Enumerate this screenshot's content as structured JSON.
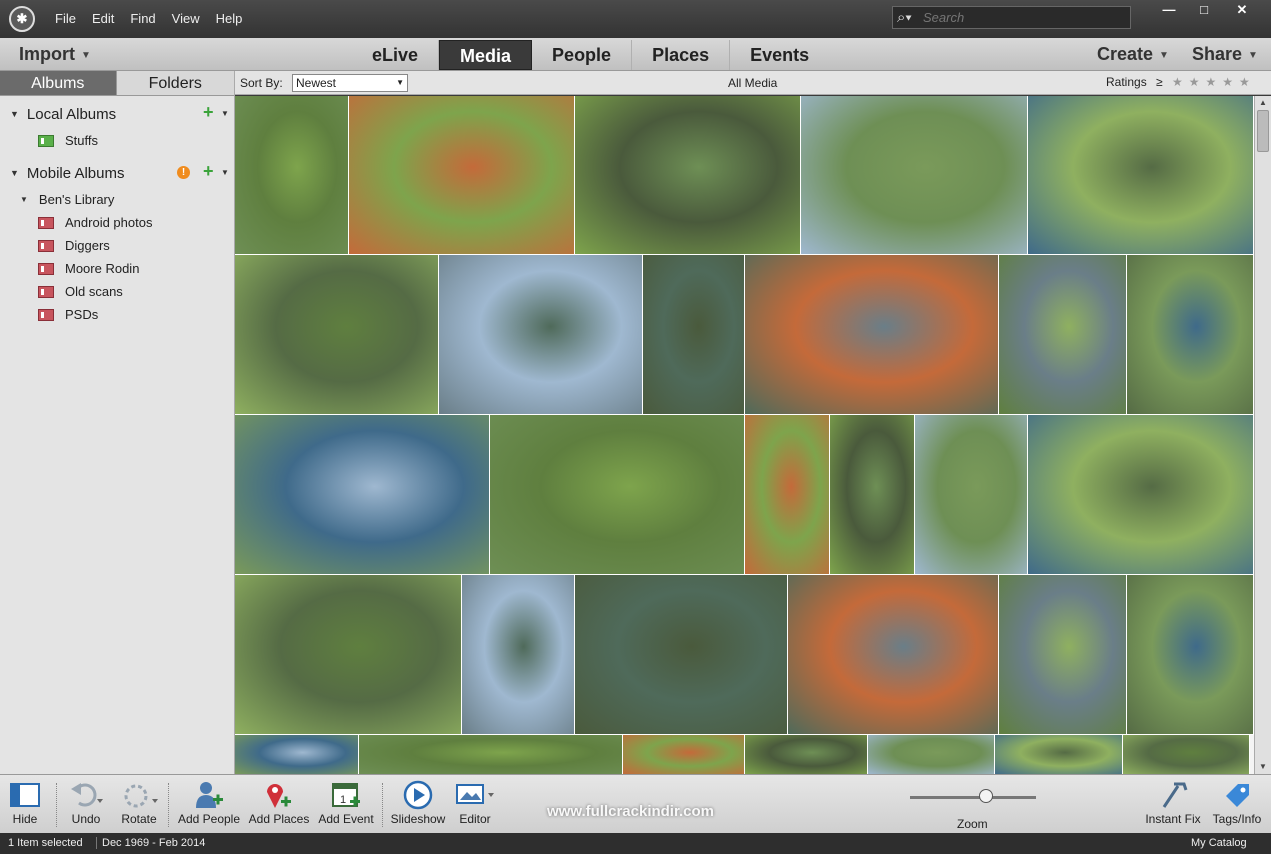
{
  "menubar": {
    "items": [
      "File",
      "Edit",
      "Find",
      "View",
      "Help"
    ]
  },
  "search": {
    "placeholder": "Search"
  },
  "tabrow": {
    "import_label": "Import",
    "tabs": [
      "eLive",
      "Media",
      "People",
      "Places",
      "Events"
    ],
    "active_tab": "Media",
    "create_label": "Create",
    "share_label": "Share"
  },
  "panel_tabs": [
    "Albums",
    "Folders"
  ],
  "local_albums": {
    "title": "Local Albums",
    "items": [
      "Stuffs"
    ]
  },
  "mobile_albums": {
    "title": "Mobile Albums",
    "library": "Ben's Library",
    "items": [
      "Android photos",
      "Diggers",
      "Moore Rodin",
      "Old scans",
      "PSDs"
    ]
  },
  "grid_header": {
    "sort_label": "Sort By:",
    "sort_value": "Newest",
    "view_title": "All Media",
    "ratings_label": "Ratings",
    "ratings_op": "≥",
    "ratings_stars": "★★★★★"
  },
  "colors": {
    "thumb_palette": [
      "#5f7f3f",
      "#7ea44c",
      "#4a5a3c",
      "#6e8f55",
      "#8fb060",
      "#556b45",
      "#9fb8d0",
      "#4f6a5a",
      "#c46a3a",
      "#6a7e88",
      "#7a9a5a",
      "#3f6a8a"
    ]
  },
  "toolbar": {
    "hide": "Hide",
    "undo": "Undo",
    "rotate": "Rotate",
    "add_people": "Add People",
    "add_places": "Add Places",
    "add_event": "Add Event",
    "slideshow": "Slideshow",
    "editor": "Editor",
    "zoom": "Zoom",
    "instant_fix": "Instant Fix",
    "tags_info": "Tags/Info"
  },
  "watermark": "www.fullcrackindir.com",
  "status": {
    "selected": "1 Item selected",
    "range": "Dec 1969 - Feb 2014",
    "catalog": "My Catalog"
  }
}
